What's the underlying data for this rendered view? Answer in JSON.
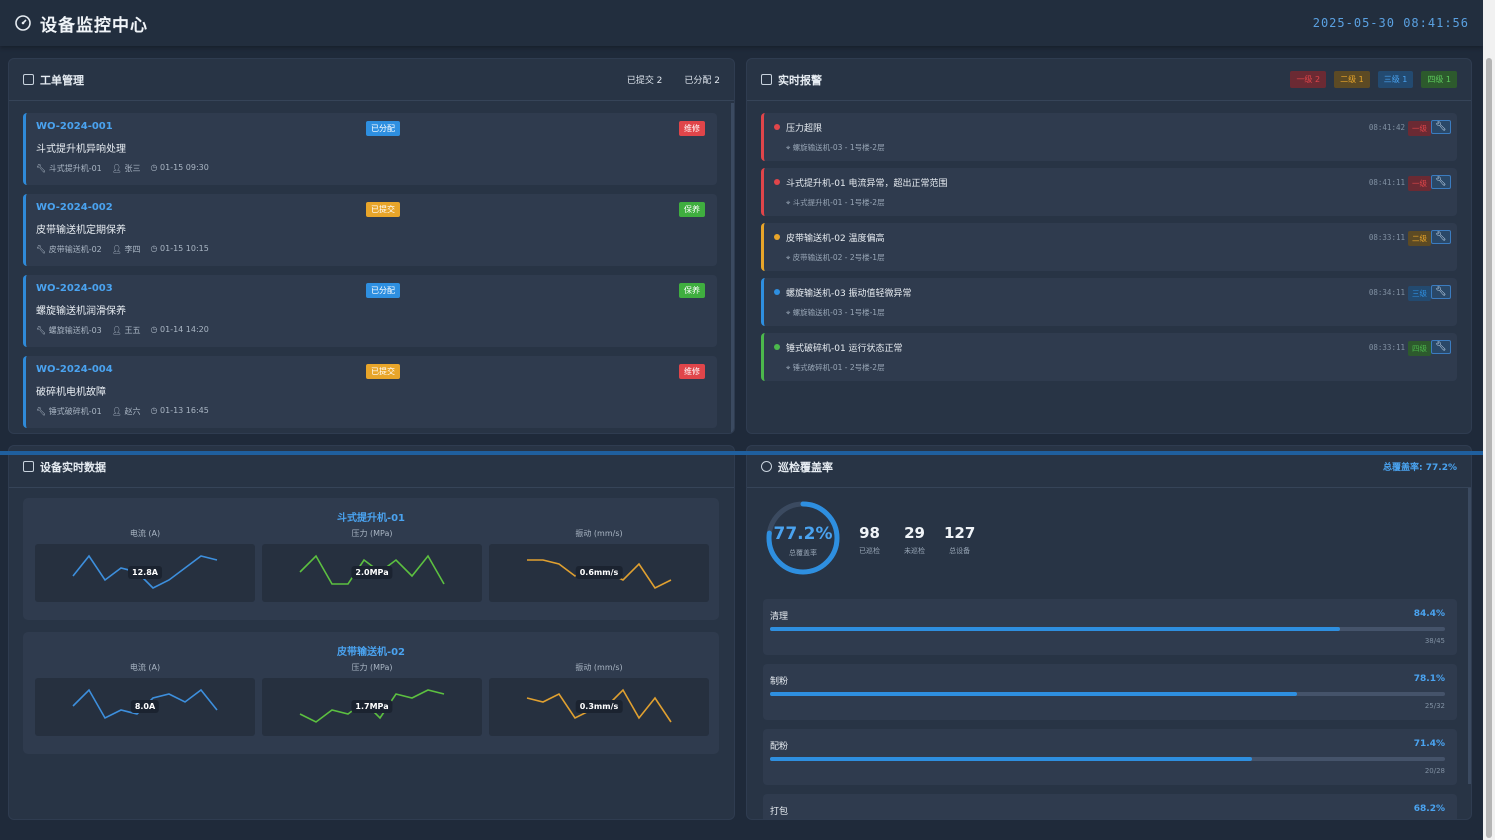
{
  "header": {
    "title": "设备监控中心",
    "datetime": "2025-05-30 08:41:56"
  },
  "work_orders": {
    "title": "工单管理",
    "filters": [
      "已提交 2",
      "已分配 2"
    ],
    "items": [
      {
        "id": "WO-2024-001",
        "status": "已分配",
        "status_kind": "assigned",
        "type": "维修",
        "type_color": "#e0454a",
        "name": "斗式提升机异响处理",
        "device": "斗式提升机-01",
        "person": "张三",
        "time": "01-15 09:30"
      },
      {
        "id": "WO-2024-002",
        "status": "已提交",
        "status_kind": "submitted",
        "type": "保养",
        "type_color": "#3fae3f",
        "name": "皮带输送机定期保养",
        "device": "皮带输送机-02",
        "person": "李四",
        "time": "01-15 10:15"
      },
      {
        "id": "WO-2024-003",
        "status": "已分配",
        "status_kind": "assigned",
        "type": "保养",
        "type_color": "#3fae3f",
        "name": "螺旋输送机润滑保养",
        "device": "螺旋输送机-03",
        "person": "王五",
        "time": "01-14 14:20"
      },
      {
        "id": "WO-2024-004",
        "status": "已提交",
        "status_kind": "submitted",
        "type": "维修",
        "type_color": "#e0454a",
        "name": "破碎机电机故障",
        "device": "锤式破碎机-01",
        "person": "赵六",
        "time": "01-13 16:45"
      }
    ]
  },
  "alarms": {
    "title": "实时报警",
    "chips": [
      {
        "label": "一级 2",
        "bg": "#6b2a33",
        "fg": "#e0454a"
      },
      {
        "label": "二级 1",
        "bg": "#5c4a24",
        "fg": "#e8a52a"
      },
      {
        "label": "三级 1",
        "bg": "#234a70",
        "fg": "#4aa3f0"
      },
      {
        "label": "四级 1",
        "bg": "#2d5a2d",
        "fg": "#5cc85c"
      }
    ],
    "items": [
      {
        "text": "压力超限",
        "location": "螺旋输送机-03 - 1号楼-2层",
        "time": "08:41:42",
        "level": "一级",
        "color": "#e0454a",
        "level_bg": "#6b2a33"
      },
      {
        "text": "斗式提升机-01 电流异常，超出正常范围",
        "location": "斗式提升机-01 - 1号楼-2层",
        "time": "08:41:11",
        "level": "一级",
        "color": "#e0454a",
        "level_bg": "#6b2a33"
      },
      {
        "text": "皮带输送机-02 温度偏高",
        "location": "皮带输送机-02 - 2号楼-1层",
        "time": "08:33:11",
        "level": "二级",
        "color": "#e8a52a",
        "level_bg": "#5c4a24"
      },
      {
        "text": "螺旋输送机-03 振动值轻微异常",
        "location": "螺旋输送机-03 - 1号楼-1层",
        "time": "08:34:11",
        "level": "三级",
        "color": "#2e8fe0",
        "level_bg": "#234a70"
      },
      {
        "text": "锤式破碎机-01 运行状态正常",
        "location": "锤式破碎机-01 - 2号楼-2层",
        "time": "08:33:11",
        "level": "四级",
        "color": "#4cb84c",
        "level_bg": "#2d5a2d"
      }
    ]
  },
  "devices": {
    "title": "设备实时数据",
    "items": [
      {
        "name": "斗式提升机-01",
        "metrics": [
          {
            "label": "电流 (A)",
            "value": "12.8A",
            "color": "#3d8fdd",
            "points": [
              4,
              9,
              3,
              6,
              5,
              1,
              3,
              6,
              9,
              8
            ]
          },
          {
            "label": "压力 (MPa)",
            "value": "2.0MPa",
            "color": "#5cc040",
            "points": [
              5,
              9,
              2,
              2,
              8,
              5,
              8,
              4,
              9,
              2
            ]
          },
          {
            "label": "振动 (mm/s)",
            "value": "0.6mm/s",
            "color": "#e0a030",
            "points": [
              8,
              8,
              7,
              4,
              6,
              5,
              3,
              7,
              1,
              3
            ]
          }
        ]
      },
      {
        "name": "皮带输送机-02",
        "metrics": [
          {
            "label": "电流 (A)",
            "value": "8.0A",
            "color": "#3d8fdd",
            "points": [
              5,
              9,
              2,
              4,
              3,
              7,
              8,
              6,
              9,
              4
            ]
          },
          {
            "label": "压力 (MPa)",
            "value": "1.7MPa",
            "color": "#5cc040",
            "points": [
              3,
              1,
              4,
              3,
              6,
              2,
              8,
              7,
              9,
              8
            ]
          },
          {
            "label": "振动 (mm/s)",
            "value": "0.3mm/s",
            "color": "#e0a030",
            "points": [
              7,
              6,
              8,
              2,
              4,
              5,
              9,
              2,
              7,
              1
            ]
          }
        ]
      }
    ]
  },
  "coverage": {
    "title": "巡检覆盖率",
    "total_label": "总覆盖率: 77.2%",
    "percent": 77.2,
    "percent_text": "77.2%",
    "percent_sub": "总覆盖率",
    "stats": [
      {
        "value": "98",
        "label": "已巡检"
      },
      {
        "value": "29",
        "label": "未巡检"
      },
      {
        "value": "127",
        "label": "总设备"
      }
    ],
    "items": [
      {
        "name": "清理",
        "percent": 84.4,
        "percent_text": "84.4%",
        "count": "38/45"
      },
      {
        "name": "制粉",
        "percent": 78.1,
        "percent_text": "78.1%",
        "count": "25/32"
      },
      {
        "name": "配粉",
        "percent": 71.4,
        "percent_text": "71.4%",
        "count": "20/28"
      },
      {
        "name": "打包",
        "percent": 68.2,
        "percent_text": "68.2%",
        "count": ""
      }
    ]
  }
}
